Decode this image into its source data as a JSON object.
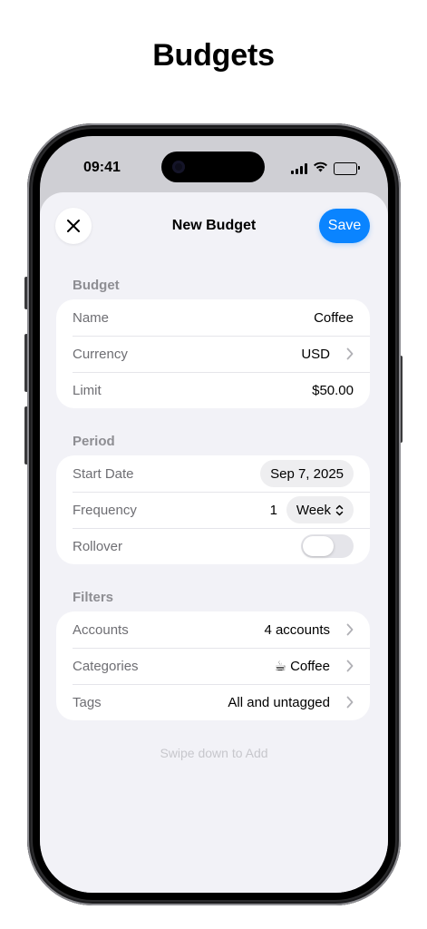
{
  "page": {
    "title": "Budgets"
  },
  "status_bar": {
    "time": "09:41"
  },
  "sheet": {
    "title": "New Budget",
    "save_label": "Save",
    "accent_color": "#0a84ff",
    "footer_hint": "Swipe down to Add"
  },
  "budget_section": {
    "header": "Budget",
    "name_label": "Name",
    "name_value": "Coffee",
    "currency_label": "Currency",
    "currency_value": "USD",
    "limit_label": "Limit",
    "limit_value": "$50.00"
  },
  "period_section": {
    "header": "Period",
    "start_date_label": "Start Date",
    "start_date_value": "Sep 7, 2025",
    "frequency_label": "Frequency",
    "frequency_count": "1",
    "frequency_unit": "Week",
    "rollover_label": "Rollover",
    "rollover_on": false
  },
  "filters_section": {
    "header": "Filters",
    "accounts_label": "Accounts",
    "accounts_value": "4 accounts",
    "categories_label": "Categories",
    "categories_value": "☕ Coffee",
    "tags_label": "Tags",
    "tags_value": "All and untagged"
  },
  "icons": {
    "close": "close-icon",
    "chevron": "chevron-right-icon",
    "stepper": "chevron-up-down-icon",
    "signal": "cellular-signal-icon",
    "wifi": "wifi-icon",
    "battery": "battery-icon"
  }
}
